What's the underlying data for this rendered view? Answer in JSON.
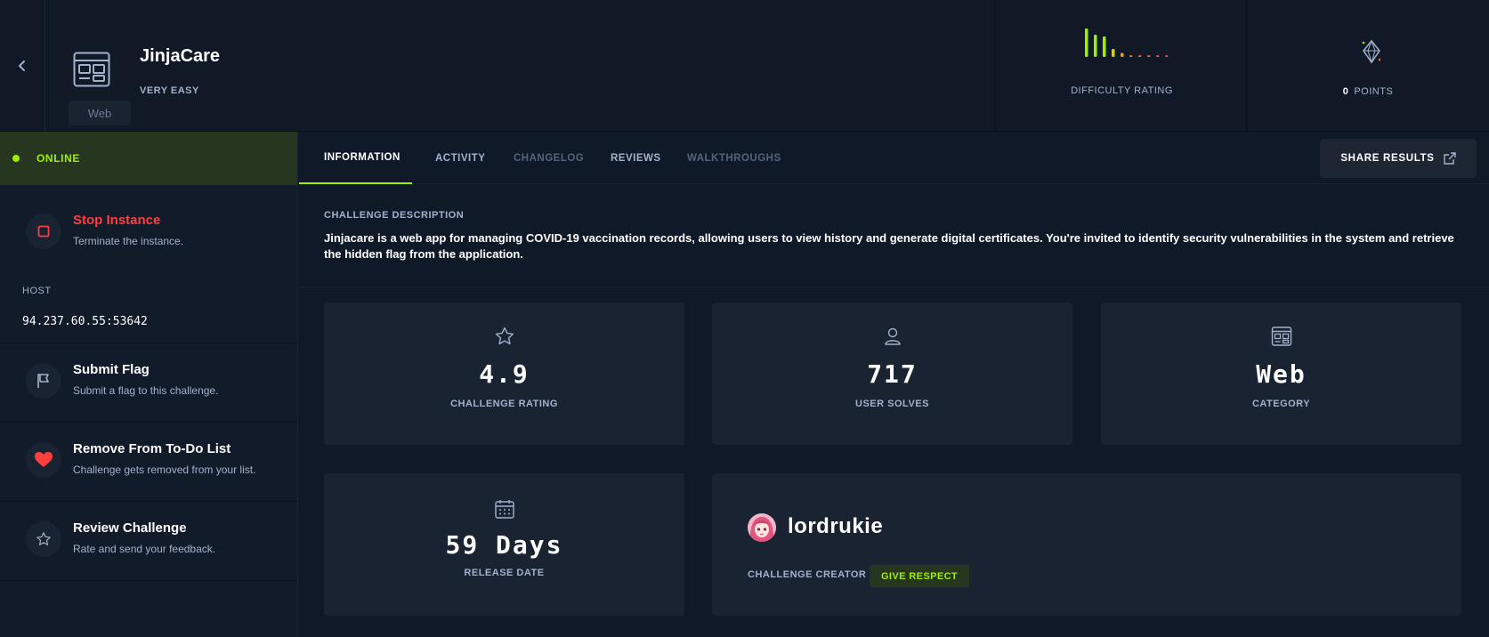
{
  "header": {
    "title": "JinjaCare",
    "difficulty": "VERY EASY",
    "category_chip": "Web",
    "difficulty_rating_label": "DIFFICULTY RATING",
    "points_value": "0",
    "points_label": "POINTS",
    "difficulty_bar_colors": [
      "#9fef00",
      "#9fef00",
      "#9fef00",
      "#d9d100",
      "#f3a300",
      "#f38800",
      "#ff6a3d",
      "#ff5c4d",
      "#ff4d5a",
      "#ff3e6c"
    ],
    "difficulty_bar_heights": [
      1.0,
      0.78,
      0.72,
      0.28,
      0.14,
      0.06,
      0.06,
      0.06,
      0.06,
      0.06
    ]
  },
  "sidebar": {
    "status": "ONLINE",
    "stop": {
      "title": "Stop Instance",
      "desc": "Terminate the instance."
    },
    "host_label": "HOST",
    "host_value": "94.237.60.55:53642",
    "submit": {
      "title": "Submit Flag",
      "desc": "Submit a flag to this challenge."
    },
    "todo": {
      "title": "Remove From To-Do List",
      "desc": "Challenge gets removed from your list."
    },
    "review": {
      "title": "Review Challenge",
      "desc": "Rate and send your feedback."
    }
  },
  "tabs": [
    "INFORMATION",
    "ACTIVITY",
    "CHANGELOG",
    "REVIEWS",
    "WALKTHROUGHS"
  ],
  "share_label": "SHARE RESULTS",
  "description": {
    "label": "CHALLENGE DESCRIPTION",
    "text": "Jinjacare is a web app for managing COVID-19 vaccination records, allowing users to view history and generate digital certificates. You're invited to identify security vulnerabilities in the system and retrieve the hidden flag from the application."
  },
  "stats": {
    "rating": {
      "value": "4.9",
      "label": "CHALLENGE RATING"
    },
    "solves": {
      "value": "717",
      "label": "USER SOLVES"
    },
    "category": {
      "value": "Web",
      "label": "CATEGORY"
    },
    "release": {
      "value": "59 Days",
      "label": "RELEASE DATE"
    }
  },
  "creator": {
    "name": "lordrukie",
    "label": "CHALLENGE CREATOR",
    "respect_label": "GIVE RESPECT"
  },
  "colors": {
    "accent_green": "#9fef00",
    "stop_red": "#ff3e3e",
    "heart_red": "#ff3e3e"
  }
}
